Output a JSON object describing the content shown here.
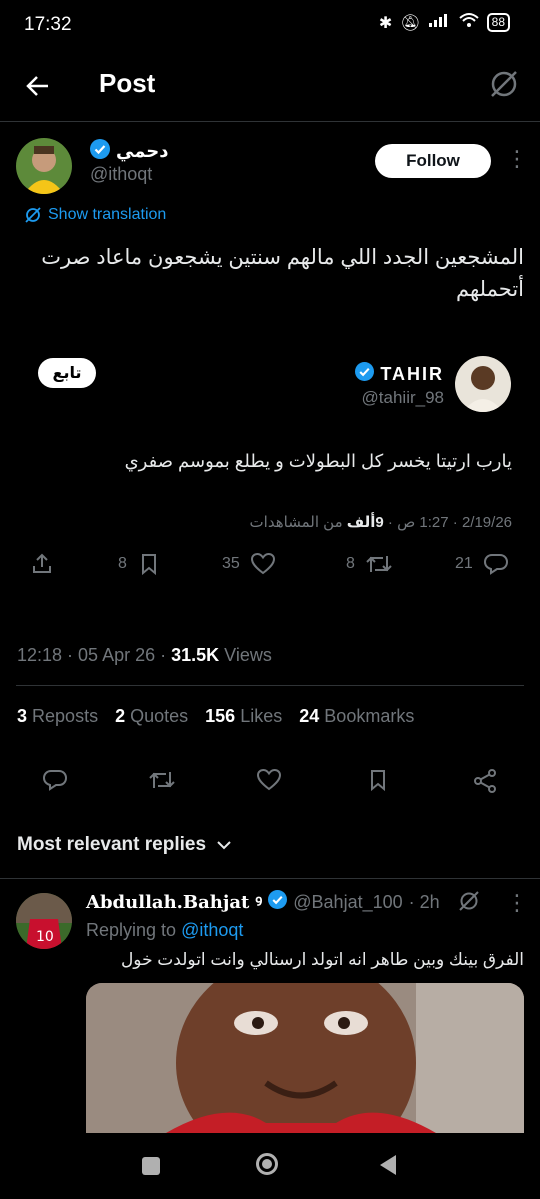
{
  "status_bar": {
    "time": "17:32",
    "battery": "88"
  },
  "header": {
    "title": "Post"
  },
  "post": {
    "author_name": "دحمي",
    "author_handle": "@ithoqt",
    "follow_label": "Follow",
    "show_translation": "Show translation",
    "text": "المشجعين الجدد اللي مالهم سنتين يشجعون ماعاد صرت أتحملهم",
    "timestamp": "12:18 · 05 Apr 26 · ",
    "views_count": "31.5K",
    "views_label": " Views"
  },
  "quoted": {
    "follow_label": "تابع",
    "name": "TAHIR",
    "handle": "@tahiir_98",
    "text": "يارب ارتيتا يخسر كل البطولات و يطلع بموسم صفري",
    "meta": "2/19/26 · 1:27 ص · ",
    "views_count": "9ألف",
    "views_label": " من المشاهدات",
    "counts": {
      "replies": "21",
      "reposts": "8",
      "likes": "35",
      "bookmarks": "8"
    }
  },
  "stats": {
    "reposts_num": "3",
    "reposts_label": "Reposts",
    "quotes_num": "2",
    "quotes_label": "Quotes",
    "likes_num": "156",
    "likes_label": "Likes",
    "bookmarks_num": "24",
    "bookmarks_label": "Bookmarks"
  },
  "replies_sort": {
    "label": "Most relevant replies"
  },
  "reply": {
    "name": "Abdullah.Bahjat",
    "emoji": "ꝰ",
    "handle": "@Bahjat_100",
    "time": " · 2h",
    "replying_to_label": "Replying to ",
    "replying_to_handle": "@ithoqt",
    "text": "الفرق بينك وبين طاهر انه اتولد ارسنالي وانت اتولدت خول"
  },
  "colors": {
    "accent": "#1d9bf0",
    "background": "#000000",
    "muted": "#71767b",
    "divider": "#2f3336"
  }
}
